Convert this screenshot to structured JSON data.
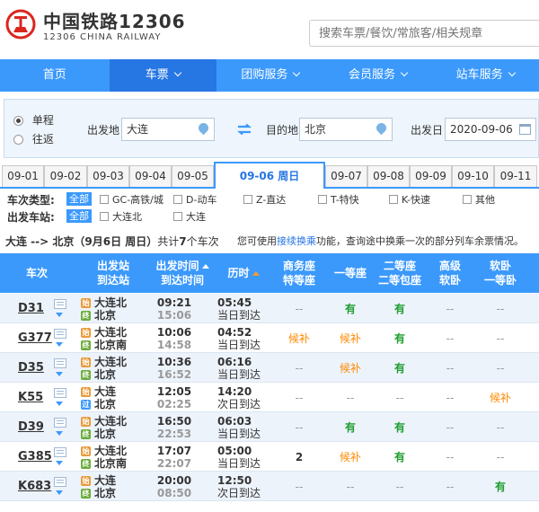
{
  "brand": {
    "name": "中国铁路12306",
    "sub": "12306 CHINA RAILWAY"
  },
  "search": {
    "placeholder": "搜索车票/餐饮/常旅客/相关规章"
  },
  "nav": [
    "首页",
    "车票",
    "团购服务",
    "会员服务",
    "站车服务"
  ],
  "form": {
    "trip_types": [
      "单程",
      "往返"
    ],
    "from_label": "出发地",
    "from_value": "大连",
    "to_label": "目的地",
    "to_value": "北京",
    "date_label": "出发日",
    "date_value": "2020-09-06"
  },
  "date_tabs": [
    "09-01",
    "09-02",
    "09-03",
    "09-04",
    "09-05",
    "09-06 周日",
    "09-07",
    "09-08",
    "09-09",
    "09-10",
    "09-11"
  ],
  "active_tab": 5,
  "filters": {
    "type_label": "车次类型:",
    "all": "全部",
    "types": [
      "GC-高铁/城",
      "D-动车",
      "Z-直达",
      "T-特快",
      "K-快速",
      "其他"
    ],
    "station_label": "出发车站:",
    "stations": [
      "大连北",
      "大连"
    ]
  },
  "summary": {
    "route": "大连 --> 北京（9月6日  周日）",
    "count_prefix": "共计",
    "count": "7",
    "count_suffix": "个车次"
  },
  "hint": {
    "before": "您可使用",
    "link": "接续换乘",
    "after": "功能，查询途中换乘一次的部分列车余票情况。"
  },
  "table": {
    "headers": {
      "train": "车次",
      "station1": "出发站",
      "station2": "到达站",
      "time1": "出发时间",
      "time2": "到达时间",
      "duration": "历时",
      "biz1": "商务座",
      "biz2": "特等座",
      "first": "一等座",
      "second1": "二等座",
      "second2": "二等包座",
      "hsleep1": "高级",
      "hsleep2": "软卧",
      "soft1": "软卧",
      "soft2": "一等卧"
    },
    "rows": [
      {
        "train": "D31",
        "from": "大连北",
        "to": "北京",
        "from_badge": "始",
        "to_badge": "终",
        "dep": "09:21",
        "arr": "15:06",
        "dur": "05:45",
        "day": "当日到达",
        "biz": "--",
        "first": "有",
        "second": "有",
        "hsleep": "--",
        "soft": "--"
      },
      {
        "train": "G377",
        "from": "大连北",
        "to": "北京南",
        "from_badge": "始",
        "to_badge": "终",
        "dep": "10:06",
        "arr": "14:58",
        "dur": "04:52",
        "day": "当日到达",
        "biz": "候补",
        "first": "候补",
        "second": "有",
        "hsleep": "--",
        "soft": "--"
      },
      {
        "train": "D35",
        "from": "大连北",
        "to": "北京",
        "from_badge": "始",
        "to_badge": "终",
        "dep": "10:36",
        "arr": "16:52",
        "dur": "06:16",
        "day": "当日到达",
        "biz": "--",
        "first": "候补",
        "second": "有",
        "hsleep": "--",
        "soft": "--"
      },
      {
        "train": "K55",
        "from": "大连",
        "to": "北京",
        "from_badge": "始",
        "to_badge": "过",
        "dep": "12:05",
        "arr": "02:25",
        "dur": "14:20",
        "day": "次日到达",
        "biz": "--",
        "first": "--",
        "second": "--",
        "hsleep": "--",
        "soft": "候补"
      },
      {
        "train": "D39",
        "from": "大连北",
        "to": "北京",
        "from_badge": "始",
        "to_badge": "终",
        "dep": "16:50",
        "arr": "22:53",
        "dur": "06:03",
        "day": "当日到达",
        "biz": "--",
        "first": "有",
        "second": "有",
        "hsleep": "--",
        "soft": "--"
      },
      {
        "train": "G385",
        "from": "大连北",
        "to": "北京南",
        "from_badge": "始",
        "to_badge": "终",
        "dep": "17:07",
        "arr": "22:07",
        "dur": "05:00",
        "day": "当日到达",
        "biz": "2",
        "first": "候补",
        "second": "有",
        "hsleep": "--",
        "soft": "--"
      },
      {
        "train": "K683",
        "from": "大连",
        "to": "北京",
        "from_badge": "始",
        "to_badge": "终",
        "dep": "20:00",
        "arr": "08:50",
        "dur": "12:50",
        "day": "次日到达",
        "biz": "--",
        "first": "--",
        "second": "--",
        "hsleep": "--",
        "soft": "有"
      }
    ]
  },
  "colors": {
    "primary": "#3b99fc",
    "primary_dark": "#2676e3",
    "available": "#1e9e2f",
    "waitlist": "#ff8a00"
  }
}
